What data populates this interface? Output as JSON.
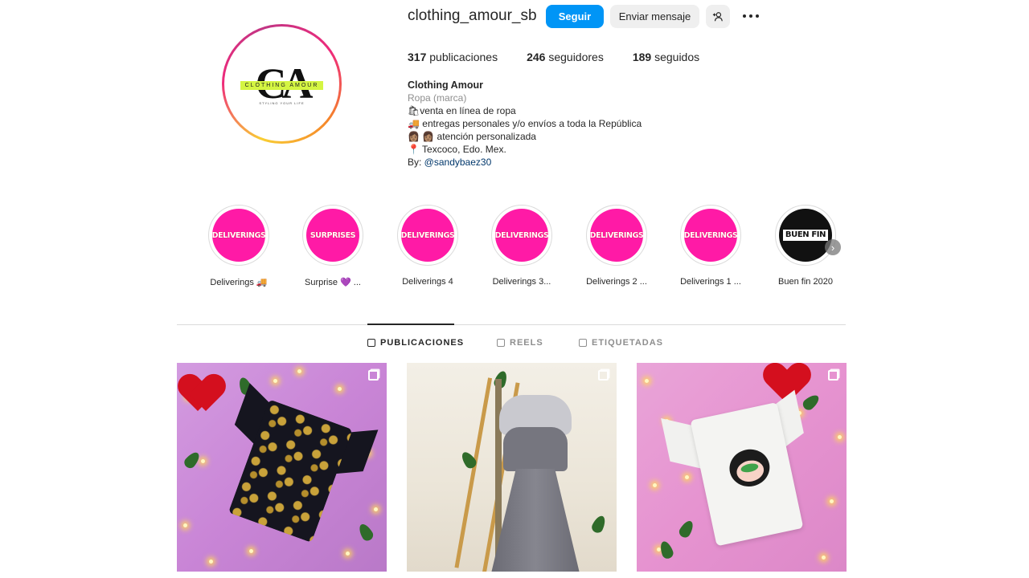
{
  "profile": {
    "username": "clothing_amour_sb",
    "follow_label": "Seguir",
    "message_label": "Enviar mensaje",
    "logo": {
      "letters": "CA",
      "band_text": "CLOTHING AMOUR",
      "sub_text": "STYLING YOUR LIFE"
    },
    "stats": {
      "posts_count": "317",
      "posts_label": " publicaciones",
      "followers_count": "246",
      "followers_label": " seguidores",
      "following_count": "189",
      "following_label": " seguidos"
    },
    "bio": {
      "name": "Clothing Amour",
      "category": "Ropa (marca)",
      "lines": [
        "🛍venta en línea de ropa",
        "🚚  entregas personales y/o envíos a toda la República",
        "👩🏽 👩🏽 atención personalizada",
        "📍 Texcoco, Edo. Mex."
      ],
      "by_prefix": "By: ",
      "by_handle": "@sandybaez30"
    }
  },
  "highlights": [
    {
      "cover": "DELIVERINGS",
      "label": "Deliverings 🚚"
    },
    {
      "cover": "SURPRISES",
      "label": "Surprise 💜 ..."
    },
    {
      "cover": "DELIVERINGS",
      "label": "Deliverings 4"
    },
    {
      "cover": "DELIVERINGS",
      "label": "Deliverings 3..."
    },
    {
      "cover": "DELIVERINGS",
      "label": "Deliverings 2 ..."
    },
    {
      "cover": "DELIVERINGS",
      "label": "Deliverings 1 ..."
    },
    {
      "cover": "BUEN FIN",
      "label": "Buen fin 2020"
    }
  ],
  "tabs": [
    {
      "label": "PUBLICACIONES",
      "icon": "grid-icon",
      "active": true
    },
    {
      "label": "REELS",
      "icon": "reels-icon",
      "active": false
    },
    {
      "label": "ETIQUETADAS",
      "icon": "tagged-icon",
      "active": false
    }
  ],
  "colors": {
    "follow_button": "#0095f6",
    "highlight_pink": "#ff1aa6",
    "logo_band": "#d4f542"
  }
}
